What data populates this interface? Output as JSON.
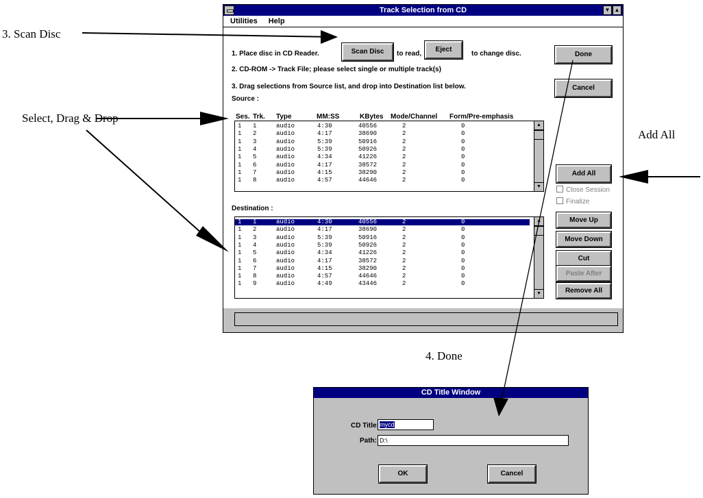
{
  "annotations": {
    "scan_disc": "3. Scan Disc",
    "select_drag_drop": "Select, Drag & Drop",
    "add_all": "Add All",
    "done": "4. Done"
  },
  "main_window": {
    "title": "Track Selection from CD",
    "menu": [
      "Utilities",
      "Help"
    ],
    "instruction1_a": "1. Place disc in CD Reader.",
    "scan_disc_button": "Scan Disc",
    "instruction1_b": "to read,",
    "eject_button": "Eject",
    "instruction1_c": "to change disc.",
    "instruction2": "2. CD-ROM -> Track File; please select single or multiple track(s)",
    "instruction3": "3. Drag selections from Source list, and drop into Destination list below.",
    "source_label": "Source :",
    "destination_label": "Destination :",
    "columns": [
      "Ses.",
      "Trk.",
      "Type",
      "MM:SS",
      "KBytes",
      "Mode/Channel",
      "Form/Pre-emphasis"
    ],
    "source_rows": [
      [
        "1",
        "1",
        "audio",
        "4:30",
        "40556",
        "2",
        "0"
      ],
      [
        "1",
        "2",
        "audio",
        "4:17",
        "38690",
        "2",
        "0"
      ],
      [
        "1",
        "3",
        "audio",
        "5:39",
        "50916",
        "2",
        "0"
      ],
      [
        "1",
        "4",
        "audio",
        "5:39",
        "50926",
        "2",
        "0"
      ],
      [
        "1",
        "5",
        "audio",
        "4:34",
        "41226",
        "2",
        "0"
      ],
      [
        "1",
        "6",
        "audio",
        "4:17",
        "38572",
        "2",
        "0"
      ],
      [
        "1",
        "7",
        "audio",
        "4:15",
        "38290",
        "2",
        "0"
      ],
      [
        "1",
        "8",
        "audio",
        "4:57",
        "44646",
        "2",
        "0"
      ]
    ],
    "destination_rows": [
      [
        "1",
        "1",
        "audio",
        "4:30",
        "40556",
        "2",
        "0"
      ],
      [
        "1",
        "2",
        "audio",
        "4:17",
        "38690",
        "2",
        "0"
      ],
      [
        "1",
        "3",
        "audio",
        "5:39",
        "50916",
        "2",
        "0"
      ],
      [
        "1",
        "4",
        "audio",
        "5:39",
        "50926",
        "2",
        "0"
      ],
      [
        "1",
        "5",
        "audio",
        "4:34",
        "41226",
        "2",
        "0"
      ],
      [
        "1",
        "6",
        "audio",
        "4:17",
        "38572",
        "2",
        "0"
      ],
      [
        "1",
        "7",
        "audio",
        "4:15",
        "38290",
        "2",
        "0"
      ],
      [
        "1",
        "8",
        "audio",
        "4:57",
        "44646",
        "2",
        "0"
      ],
      [
        "1",
        "9",
        "audio",
        "4:49",
        "43446",
        "2",
        "0"
      ]
    ],
    "buttons": {
      "done": "Done",
      "cancel": "Cancel",
      "add_all": "Add All",
      "move_up": "Move Up",
      "move_down": "Move Down",
      "cut": "Cut",
      "paste_after": "Paste After",
      "remove_all": "Remove All"
    },
    "close_session": "Close Session",
    "finalize": "Finalize"
  },
  "cd_title_window": {
    "title": "CD Title Window",
    "cd_title_label": "CD Title:",
    "cd_title_value": "mycd",
    "path_label": "Path:",
    "path_value": "D:\\",
    "ok": "OK",
    "cancel": "Cancel"
  }
}
